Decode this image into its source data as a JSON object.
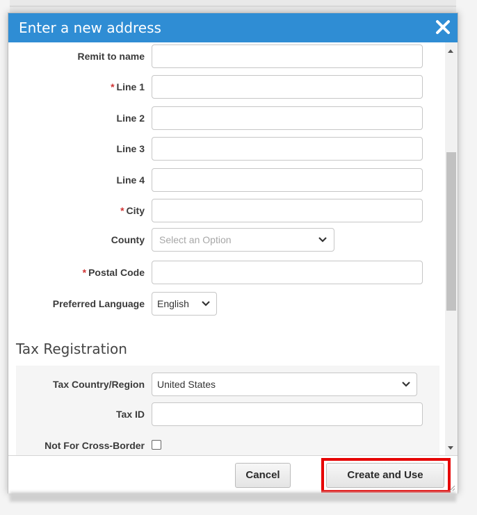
{
  "dialog": {
    "title": "Enter a new address",
    "close_icon": "close-icon"
  },
  "form": {
    "remit_to_name": {
      "label": "Remit to name",
      "value": ""
    },
    "line1": {
      "required_mark": "*",
      "label": "Line 1",
      "value": ""
    },
    "line2": {
      "label": "Line 2",
      "value": ""
    },
    "line3": {
      "label": "Line 3",
      "value": ""
    },
    "line4": {
      "label": "Line 4",
      "value": ""
    },
    "city": {
      "required_mark": "*",
      "label": "City",
      "value": ""
    },
    "county": {
      "label": "County",
      "placeholder": "Select an Option"
    },
    "postal_code": {
      "required_mark": "*",
      "label": "Postal Code",
      "value": ""
    },
    "preferred_language": {
      "label": "Preferred Language",
      "value": "English"
    }
  },
  "tax": {
    "section_title": "Tax Registration",
    "country": {
      "label": "Tax Country/Region",
      "value": "United States"
    },
    "tax_id": {
      "label": "Tax ID",
      "value": ""
    },
    "cross_border": {
      "label": "Not For Cross-Border",
      "checked": false
    }
  },
  "footer": {
    "cancel_label": "Cancel",
    "create_label": "Create and Use"
  },
  "colors": {
    "titlebar": "#2f8dd4",
    "required": "#d03434",
    "highlight": "#e60000"
  }
}
